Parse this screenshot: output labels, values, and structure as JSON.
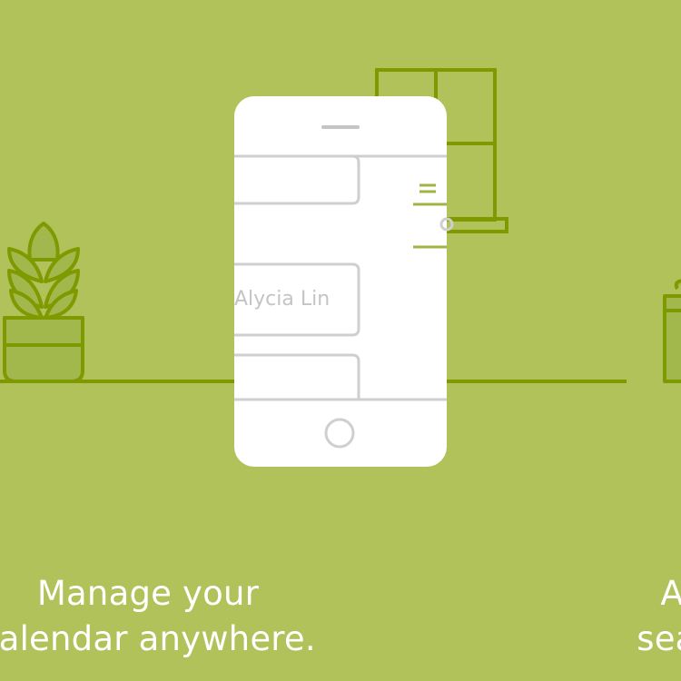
{
  "slides": [
    {
      "caption_line_1": "Manage your",
      "caption_line_2": "calendar anywhere."
    },
    {
      "caption_line_1": "An",
      "caption_line_2": "seam"
    }
  ],
  "phone": {
    "contact_name": "Alycia Lin"
  },
  "illustration": {
    "plant_icon": "potted-plant-icon",
    "window_icon": "window-icon",
    "second_plant_icon": "potted-plant-icon",
    "phone_icon": "smartphone-icon"
  },
  "colors": {
    "background": "#b0c259",
    "line_art": "#7f9a00",
    "phone_body": "#ffffff",
    "phone_lines": "#cfcfcf",
    "caption_text": "#ffffff"
  }
}
